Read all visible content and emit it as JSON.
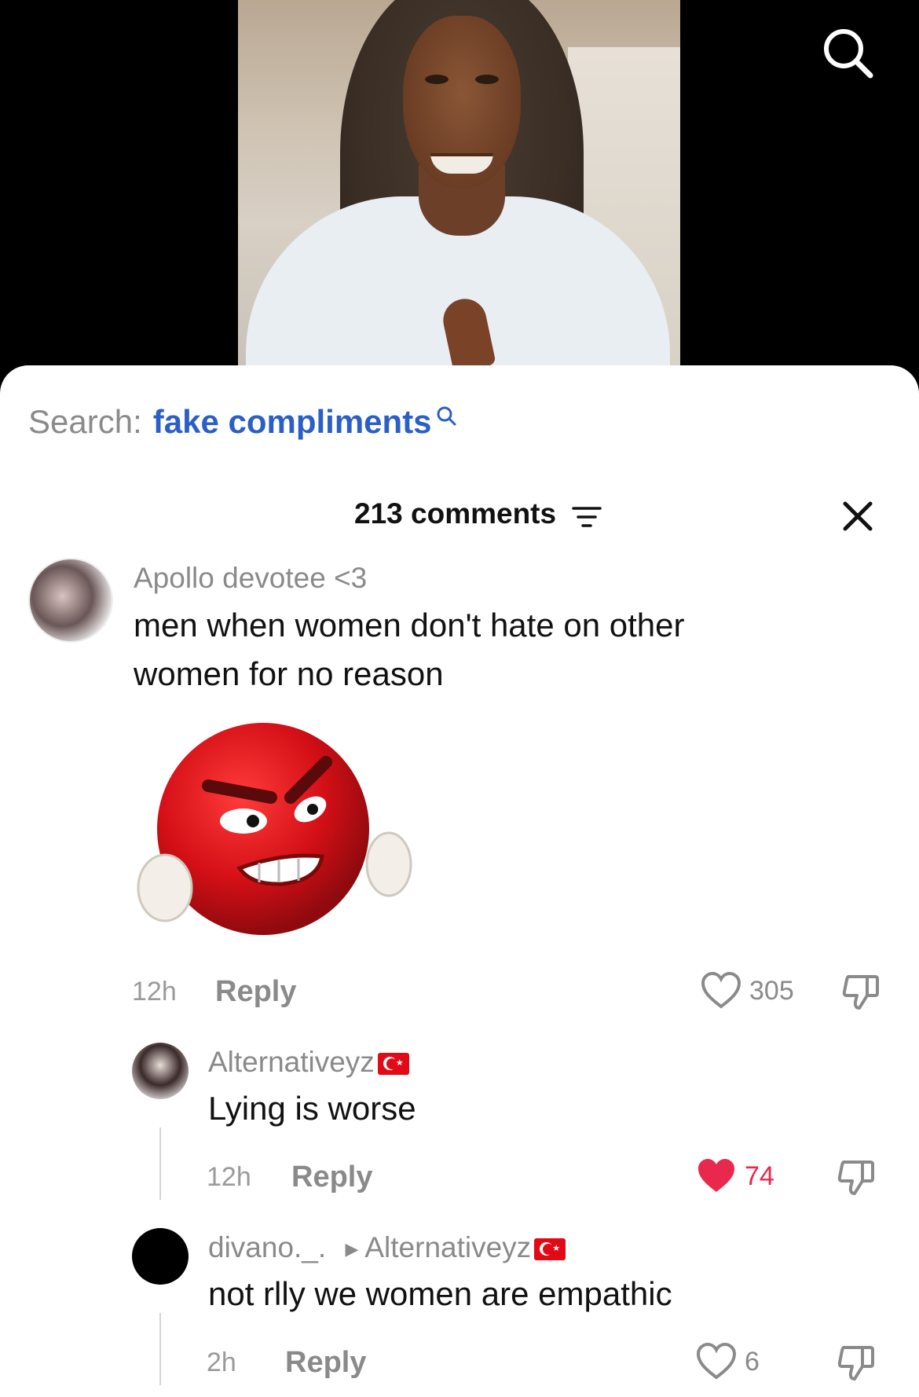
{
  "video": {
    "search_icon": "search-icon"
  },
  "sheet": {
    "search_label": "Search:",
    "search_term": "fake compliments",
    "comment_count": "213 comments",
    "filter_icon": "filter-icon",
    "close_icon": "close-icon"
  },
  "comments": [
    {
      "username": "Apollo devotee <3",
      "text": "men when women don't hate on other women for no reason",
      "sticker": "angry-red-emoji-sticker",
      "time": "12h",
      "reply_label": "Reply",
      "likes": "305",
      "liked": false
    },
    {
      "username": "Alternativeyz",
      "flag": "turkey-flag",
      "text": "Lying is worse",
      "time": "12h",
      "reply_label": "Reply",
      "likes": "74",
      "liked": true
    },
    {
      "username": "divano._.",
      "reply_to": "Alternativeyz",
      "flag": "turkey-flag",
      "text": "not rlly we women are empathic",
      "time": "2h",
      "reply_label": "Reply",
      "likes": "6",
      "liked": false
    }
  ],
  "colors": {
    "accent_link": "#2b5fc8",
    "like_red": "#e9284e",
    "muted": "#8a8a8a"
  }
}
